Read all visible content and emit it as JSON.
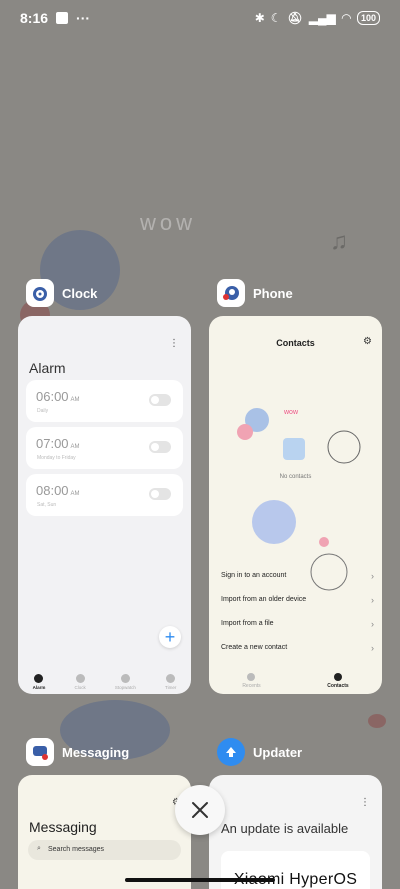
{
  "status_bar": {
    "time": "8:16",
    "dots": "···",
    "battery": "100"
  },
  "apps": {
    "clock": {
      "label": "Clock",
      "screen_title": "Alarm",
      "alarms": [
        {
          "time": "06:00",
          "ampm": "AM",
          "sub": "Daily"
        },
        {
          "time": "07:00",
          "ampm": "AM",
          "sub": "Monday to Friday"
        },
        {
          "time": "08:00",
          "ampm": "AM",
          "sub": "Sat, Sun"
        }
      ],
      "add_label": "+",
      "tabs": [
        "Alarm",
        "Clock",
        "Stopwatch",
        "Timer"
      ]
    },
    "phone": {
      "label": "Phone",
      "screen_title": "Contacts",
      "empty_text": "No contacts",
      "wall_text": "wow",
      "options": [
        "Sign in to an account",
        "Import from an older device",
        "Import from a file",
        "Create a new contact"
      ],
      "tabs": [
        "Recents",
        "Contacts"
      ]
    },
    "messaging": {
      "label": "Messaging",
      "screen_title": "Messaging",
      "search_placeholder": "Search messages"
    },
    "updater": {
      "label": "Updater",
      "screen_title": "An update is available",
      "logo_text": "Xiaomi HyperOS"
    }
  },
  "wallpaper_text": "wow",
  "close_label": "✕"
}
